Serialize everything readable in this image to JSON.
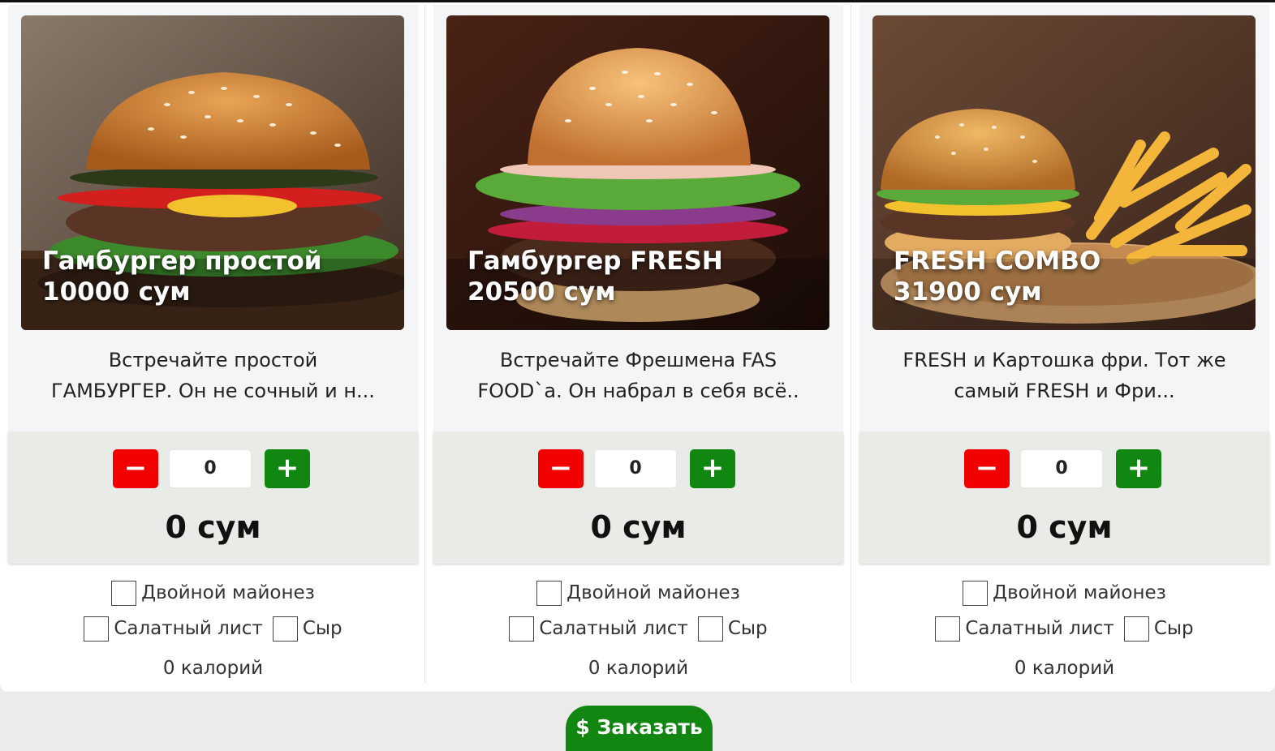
{
  "currency_sign": "$",
  "order_button_label": "Заказать",
  "products": [
    {
      "name": "Гамбургер простой",
      "price": "10000 сум",
      "description_line1": "Встречайте простой",
      "description_line2": "ГАМБУРГЕР. Он не сочный и н...",
      "minus": "−",
      "plus": "+",
      "quantity": "0",
      "total": "0 сум",
      "option_double_mayo": "Двойной майонез",
      "option_lettuce": "Салатный лист",
      "option_cheese": "Сыр",
      "calories": "0 калорий"
    },
    {
      "name": "Гамбургер FRESH",
      "price": "20500 сум",
      "description_line1": "Встречайте Фрешмена FAS",
      "description_line2": "FOOD`а. Он набрал в себя всё..",
      "minus": "−",
      "plus": "+",
      "quantity": "0",
      "total": "0 сум",
      "option_double_mayo": "Двойной майонез",
      "option_lettuce": "Салатный лист",
      "option_cheese": "Сыр",
      "calories": "0 калорий"
    },
    {
      "name": "FRESH COMBO",
      "price": "31900 сум",
      "description_line1": "FRESH и Картошка фри. Тот же",
      "description_line2": "самый FRESH и Фри...",
      "minus": "−",
      "plus": "+",
      "quantity": "0",
      "total": "0 сум",
      "option_double_mayo": "Двойной майонез",
      "option_lettuce": "Салатный лист",
      "option_cheese": "Сыр",
      "calories": "0 калорий"
    }
  ],
  "colors": {
    "minus_button": "#f20000",
    "plus_button": "#118611",
    "order_button": "#118611",
    "order_box_bg": "#e9ebe6"
  }
}
